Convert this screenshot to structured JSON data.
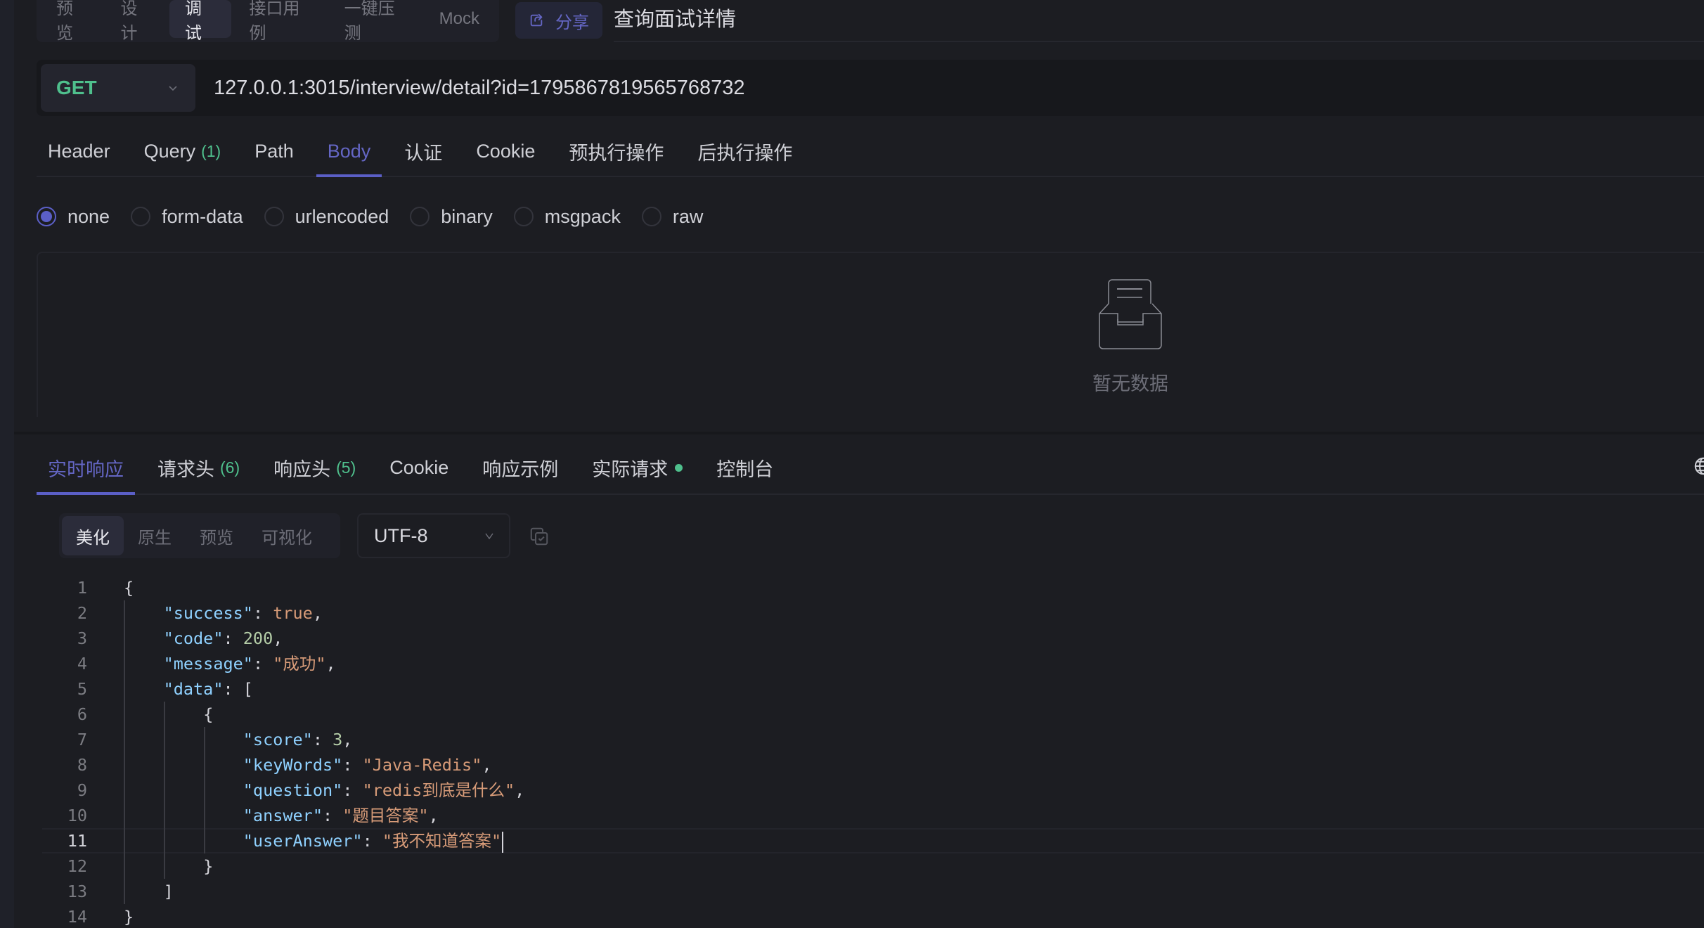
{
  "mode_tabs": [
    {
      "label": "预览",
      "active": false
    },
    {
      "label": "设计",
      "active": false
    },
    {
      "label": "调试",
      "active": true
    },
    {
      "label": "接口用例",
      "active": false
    },
    {
      "label": "一键压测",
      "active": false
    },
    {
      "label": "Mock",
      "active": false
    }
  ],
  "share": {
    "label": "分享",
    "icon": "share-icon"
  },
  "page_title": "查询面试详情",
  "request": {
    "method": "GET",
    "url": "127.0.0.1:3015/interview/detail?id=1795867819565768732"
  },
  "request_tabs": [
    {
      "label": "Header",
      "count": null,
      "active": false
    },
    {
      "label": "Query",
      "count": "(1)",
      "active": false
    },
    {
      "label": "Path",
      "count": null,
      "active": false
    },
    {
      "label": "Body",
      "count": null,
      "active": true
    },
    {
      "label": "认证",
      "count": null,
      "active": false
    },
    {
      "label": "Cookie",
      "count": null,
      "active": false
    },
    {
      "label": "预执行操作",
      "count": null,
      "active": false
    },
    {
      "label": "后执行操作",
      "count": null,
      "active": false
    }
  ],
  "body_types": [
    {
      "label": "none",
      "checked": true
    },
    {
      "label": "form-data",
      "checked": false
    },
    {
      "label": "urlencoded",
      "checked": false
    },
    {
      "label": "binary",
      "checked": false
    },
    {
      "label": "msgpack",
      "checked": false
    },
    {
      "label": "raw",
      "checked": false
    }
  ],
  "empty_state": {
    "text": "暂无数据",
    "icon": "empty-inbox-icon"
  },
  "response_tabs": [
    {
      "label": "实时响应",
      "count": null,
      "active": true,
      "dot": false
    },
    {
      "label": "请求头",
      "count": "(6)",
      "active": false,
      "dot": false
    },
    {
      "label": "响应头",
      "count": "(5)",
      "active": false,
      "dot": false
    },
    {
      "label": "Cookie",
      "count": null,
      "active": false,
      "dot": false
    },
    {
      "label": "响应示例",
      "count": null,
      "active": false,
      "dot": false
    },
    {
      "label": "实际请求",
      "count": null,
      "active": false,
      "dot": true
    },
    {
      "label": "控制台",
      "count": null,
      "active": false,
      "dot": false
    }
  ],
  "view_modes": [
    {
      "label": "美化",
      "active": true
    },
    {
      "label": "原生",
      "active": false
    },
    {
      "label": "预览",
      "active": false
    },
    {
      "label": "可视化",
      "active": false
    }
  ],
  "encoding": "UTF-8",
  "colors": {
    "accent": "#5b5fc7",
    "success": "#4fc08d",
    "background": "#1c1d22"
  },
  "response_body": {
    "current_line": 11,
    "lines": [
      {
        "n": "1",
        "indent": 0,
        "tokens": [
          {
            "t": "p",
            "v": "{"
          }
        ]
      },
      {
        "n": "2",
        "indent": 1,
        "tokens": [
          {
            "t": "k",
            "v": "\"success\""
          },
          {
            "t": "p",
            "v": ": "
          },
          {
            "t": "b",
            "v": "true"
          },
          {
            "t": "p",
            "v": ","
          }
        ]
      },
      {
        "n": "3",
        "indent": 1,
        "tokens": [
          {
            "t": "k",
            "v": "\"code\""
          },
          {
            "t": "p",
            "v": ": "
          },
          {
            "t": "n",
            "v": "200"
          },
          {
            "t": "p",
            "v": ","
          }
        ]
      },
      {
        "n": "4",
        "indent": 1,
        "tokens": [
          {
            "t": "k",
            "v": "\"message\""
          },
          {
            "t": "p",
            "v": ": "
          },
          {
            "t": "s",
            "v": "\"成功\""
          },
          {
            "t": "p",
            "v": ","
          }
        ]
      },
      {
        "n": "5",
        "indent": 1,
        "tokens": [
          {
            "t": "k",
            "v": "\"data\""
          },
          {
            "t": "p",
            "v": ": ["
          }
        ]
      },
      {
        "n": "6",
        "indent": 2,
        "tokens": [
          {
            "t": "p",
            "v": "{"
          }
        ]
      },
      {
        "n": "7",
        "indent": 3,
        "tokens": [
          {
            "t": "k",
            "v": "\"score\""
          },
          {
            "t": "p",
            "v": ": "
          },
          {
            "t": "n",
            "v": "3"
          },
          {
            "t": "p",
            "v": ","
          }
        ]
      },
      {
        "n": "8",
        "indent": 3,
        "tokens": [
          {
            "t": "k",
            "v": "\"keyWords\""
          },
          {
            "t": "p",
            "v": ": "
          },
          {
            "t": "s",
            "v": "\"Java-Redis\""
          },
          {
            "t": "p",
            "v": ","
          }
        ]
      },
      {
        "n": "9",
        "indent": 3,
        "tokens": [
          {
            "t": "k",
            "v": "\"question\""
          },
          {
            "t": "p",
            "v": ": "
          },
          {
            "t": "s",
            "v": "\"redis到底是什么\""
          },
          {
            "t": "p",
            "v": ","
          }
        ]
      },
      {
        "n": "10",
        "indent": 3,
        "tokens": [
          {
            "t": "k",
            "v": "\"answer\""
          },
          {
            "t": "p",
            "v": ": "
          },
          {
            "t": "s",
            "v": "\"题目答案\""
          },
          {
            "t": "p",
            "v": ","
          }
        ]
      },
      {
        "n": "11",
        "indent": 3,
        "tokens": [
          {
            "t": "k",
            "v": "\"userAnswer\""
          },
          {
            "t": "p",
            "v": ": "
          },
          {
            "t": "s",
            "v": "\"我不知道答案\""
          }
        ]
      },
      {
        "n": "12",
        "indent": 2,
        "tokens": [
          {
            "t": "p",
            "v": "}"
          }
        ]
      },
      {
        "n": "13",
        "indent": 1,
        "tokens": [
          {
            "t": "p",
            "v": "]"
          }
        ]
      },
      {
        "n": "14",
        "indent": 0,
        "tokens": [
          {
            "t": "p",
            "v": "}"
          }
        ]
      }
    ]
  }
}
